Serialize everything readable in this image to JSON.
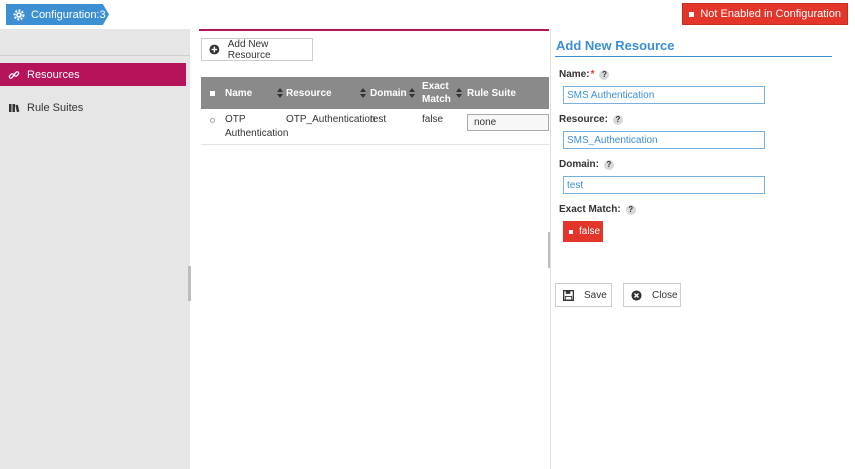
{
  "header": {
    "config_label": "Configuration:3",
    "status_label": "Not Enabled in Configuration"
  },
  "sidebar": {
    "items": [
      {
        "label": "Resources",
        "icon": "link-icon",
        "active": true
      },
      {
        "label": "Rule Suites",
        "icon": "books-icon",
        "active": false
      }
    ]
  },
  "main": {
    "add_button_label": "Add New Resource",
    "table": {
      "columns": [
        "Name",
        "Resource",
        "Domain",
        "Exact Match",
        "Rule Suite"
      ],
      "rows": [
        {
          "name_line1": "OTP",
          "name_line2": "Authentication",
          "resource": "OTP_Authentication",
          "domain": "test",
          "exact_match": "false",
          "rule_suite": "none"
        }
      ]
    }
  },
  "panel": {
    "title": "Add New Resource",
    "name_label": "Name:",
    "name_required": "*",
    "name_value": "SMS Authentication",
    "resource_label": "Resource:",
    "resource_value": "SMS_Authentication",
    "domain_label": "Domain:",
    "domain_value": "test",
    "exact_match_label": "Exact Match:",
    "exact_match_value": "false",
    "help_glyph": "?",
    "save_label": "Save",
    "close_label": "Close"
  },
  "colors": {
    "accent_blue": "#3d8fd4",
    "active_magenta": "#b5135a",
    "alert_red": "#e4352a",
    "table_header_gray": "#8a8a8a",
    "sidebar_bg": "#e6e6e6"
  }
}
